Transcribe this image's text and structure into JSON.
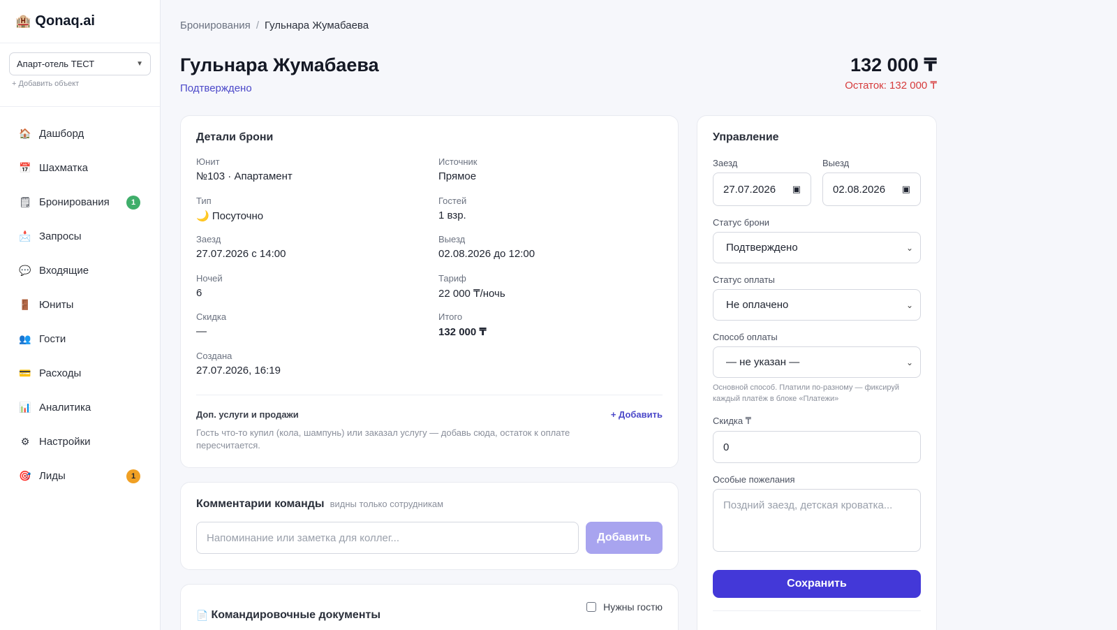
{
  "brand": {
    "icon": "🏨",
    "name": "Qonaq.ai"
  },
  "property": {
    "selected": "Апарт-отель ТЕСТ",
    "add_label": "+ Добавить объект"
  },
  "nav": [
    {
      "icon": "🏠",
      "icon_name": "home-icon",
      "label": "Дашборд",
      "badge": ""
    },
    {
      "icon": "📅",
      "icon_name": "calendar-icon",
      "label": "Шахматка",
      "badge": ""
    },
    {
      "icon": "🗒",
      "icon_name": "notepad-icon",
      "label": "Бронирования",
      "badge": "1"
    },
    {
      "icon": "📩",
      "icon_name": "envelope-icon",
      "label": "Запросы",
      "badge": ""
    },
    {
      "icon": "💬",
      "icon_name": "chat-bubble-icon",
      "label": "Входящие",
      "badge": ""
    },
    {
      "icon": "🚪",
      "icon_name": "door-icon",
      "label": "Юниты",
      "badge": ""
    },
    {
      "icon": "👥",
      "icon_name": "people-icon",
      "label": "Гости",
      "badge": ""
    },
    {
      "icon": "💳",
      "icon_name": "credit-card-icon",
      "label": "Расходы",
      "badge": ""
    },
    {
      "icon": "📊",
      "icon_name": "bar-chart-icon",
      "label": "Аналитика",
      "badge": ""
    },
    {
      "icon": "⚙",
      "icon_name": "gear-icon",
      "label": "Настройки",
      "badge": ""
    },
    {
      "icon": "🎯",
      "icon_name": "target-icon",
      "label": "Лиды",
      "badge": "1"
    }
  ],
  "breadcrumb": {
    "parent": "Бронирования",
    "separator": "/",
    "current": "Гульнара Жумабаева"
  },
  "header": {
    "guest_name": "Гульнара Жумабаева",
    "status": "Подтверждено",
    "total": "132 000 ₸",
    "remaining": "Остаток: 132 000 ₸"
  },
  "details": {
    "title": "Детали брони",
    "fields": [
      {
        "label": "Юнит",
        "value": "№103 · Апартамент"
      },
      {
        "label": "Источник",
        "value": "Прямое"
      },
      {
        "label": "Тип",
        "value": "🌙 Посуточно"
      },
      {
        "label": "Гостей",
        "value": "1 взр."
      },
      {
        "label": "Заезд",
        "value": "27.07.2026 с 14:00"
      },
      {
        "label": "Выезд",
        "value": "02.08.2026 до 12:00"
      },
      {
        "label": "Ночей",
        "value": "6"
      },
      {
        "label": "Тариф",
        "value": "22 000 ₸/ночь"
      },
      {
        "label": "Скидка",
        "value": "—"
      },
      {
        "label": "Итого",
        "value": "132 000 ₸"
      },
      {
        "label": "Создана",
        "value": "27.07.2026, 16:19"
      }
    ],
    "extras": {
      "title": "Доп. услуги и продажи",
      "add_label": "+ Добавить",
      "hint": "Гость что-то купил (кола, шампунь) или заказал услугу — добавь сюда, остаток к оплате пересчитается."
    }
  },
  "comments": {
    "title": "Комментарии команды",
    "subtitle": "видны только сотрудникам",
    "placeholder": "Напоминание или заметка для коллег...",
    "add_label": "Добавить"
  },
  "docs": {
    "icon": "📄",
    "title": "Командировочные документы",
    "checkbox_label": "Нужны гостю"
  },
  "manage": {
    "title": "Управление",
    "checkin_label": "Заезд",
    "checkin_value": "27.07.2026",
    "checkout_label": "Выезд",
    "checkout_value": "02.08.2026",
    "booking_status_label": "Статус брони",
    "booking_status_value": "Подтверждено",
    "payment_status_label": "Статус оплаты",
    "payment_status_value": "Не оплачено",
    "payment_method_label": "Способ оплаты",
    "payment_method_value": "— не указан —",
    "payment_method_hint": "Основной способ. Платили по-разному — фиксируй каждый платёж в блоке «Платежи»",
    "discount_label": "Скидка ₸",
    "discount_value": "0",
    "wishes_label": "Особые пожелания",
    "wishes_placeholder": "Поздний заезд, детская кроватка...",
    "save_label": "Сохранить"
  },
  "colors": {
    "accent": "#4338d8",
    "status_link": "#4b48c9",
    "remaining": "#d63b3b",
    "badge_green": "#3fae6a",
    "badge_orange": "#f0a024"
  }
}
